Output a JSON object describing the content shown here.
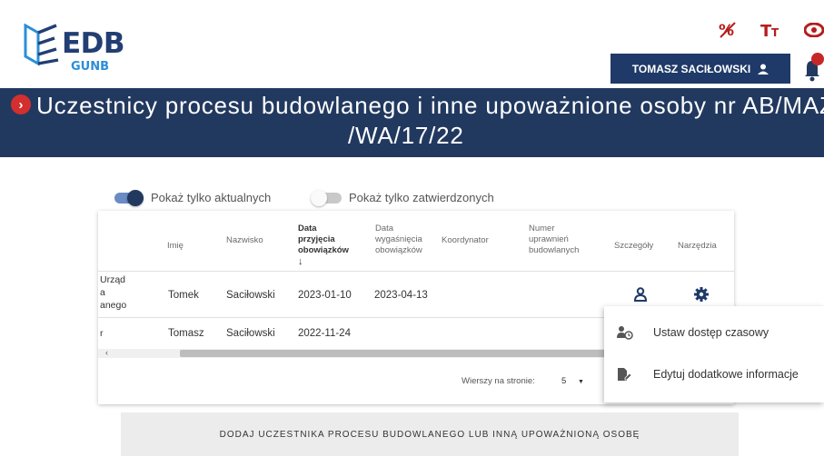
{
  "header": {
    "logo_text": "EDB",
    "logo_subtext": "GUNB",
    "icons": [
      "contrast-icon",
      "text-size-icon",
      "eye-icon"
    ],
    "user_button_label": "TOMASZ SACIŁOWSKI",
    "user_icon": "person-icon",
    "notification_icon": "bell-icon"
  },
  "title": {
    "line1": "Uczestnicy procesu budowlanego i inne upoważnione osoby nr AB/MAZ",
    "line2": "/WA/17/22"
  },
  "filters": {
    "show_current_label": "Pokaż tylko aktualnych",
    "show_current_on": true,
    "show_approved_label": "Pokaż tylko zatwierdzonych",
    "show_approved_on": false
  },
  "table": {
    "columns": {
      "first_name": "Imię",
      "last_name": "Nazwisko",
      "accepted": [
        "Data",
        "przyjęcia",
        "obowiązków"
      ],
      "accepted_sort_arrow": "↓",
      "expired": [
        "Data",
        "wygaśnięcia",
        "obowiązków"
      ],
      "coordinator": "Koordynator",
      "permission_no": [
        "Numer",
        "uprawnień",
        "budowlanych"
      ],
      "details": "Szczegóły",
      "tools": "Narzędzia"
    },
    "rows": [
      {
        "role_fragment": [
          "Urząd",
          "a",
          "anego"
        ],
        "first_name": "Tomek",
        "last_name": "Saciłowski",
        "accepted": "2023-01-10",
        "expired": "2023-04-13",
        "coordinator": "",
        "permission_no": ""
      },
      {
        "role_fragment": [
          "r"
        ],
        "first_name": "Tomasz",
        "last_name": "Saciłowski",
        "accepted": "2022-11-24",
        "expired": "",
        "coordinator": "",
        "permission_no": ""
      }
    ],
    "rows_per_page_label": "Wierszy na stronie:",
    "rows_per_page_value": "5",
    "scroll_left": "‹"
  },
  "menu": {
    "items": [
      {
        "label": "Ustaw dostęp czasowy",
        "icon": "person-clock-icon"
      },
      {
        "label": "Edytuj dodatkowe informacje",
        "icon": "edit-document-icon"
      }
    ]
  },
  "add_button_label": "DODAJ UCZESTNIKA PROCESU BUDOWLANEGO LUB INNĄ UPOWAŻNIONĄ OSOBĘ",
  "colors": {
    "navy": "#22395f",
    "accent_red": "#c62828",
    "logo_blue": "#2a8ed8"
  }
}
